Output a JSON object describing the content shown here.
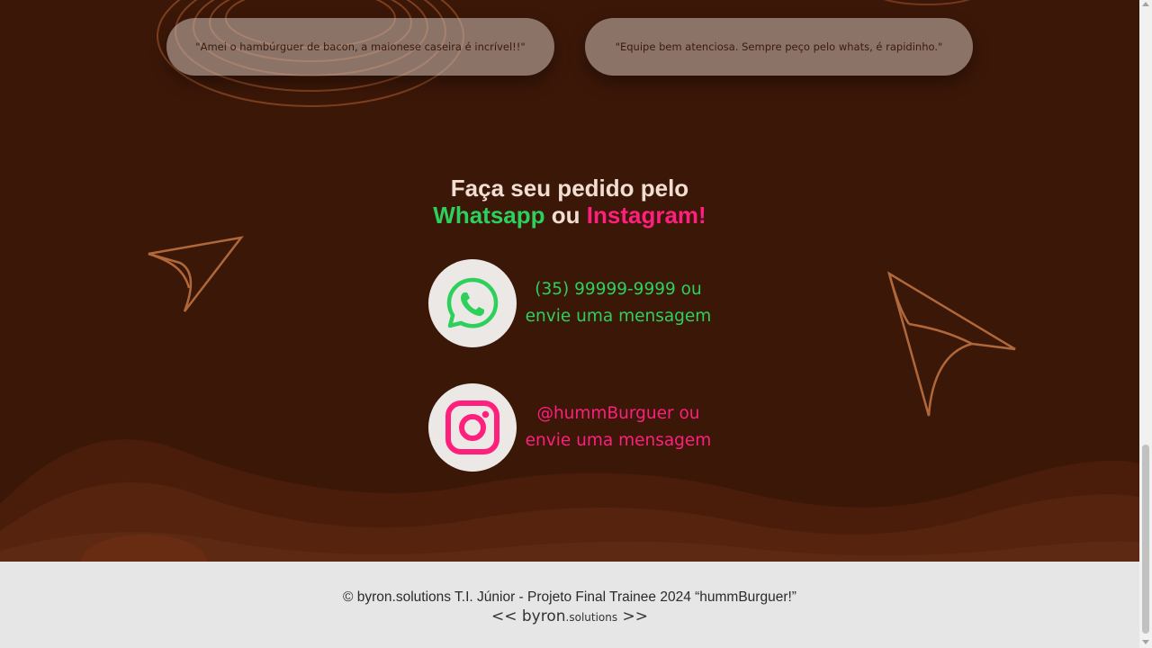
{
  "testimonials": [
    {
      "text": "\"Amei o hambúrguer de bacon, a maionese caseira é incrível!!\""
    },
    {
      "text": "\"Equipe bem atenciosa. Sempre peço pelo whats, é rapidinho.\""
    }
  ],
  "cta": {
    "line1": "Faça seu pedido pelo",
    "whatsapp": "Whatsapp",
    "or": "ou",
    "instagram": "Instagram!"
  },
  "contacts": {
    "whatsapp": {
      "line1": "(35) 99999-9999 ou",
      "line2": "envie uma mensagem",
      "icon": "whatsapp-icon"
    },
    "instagram": {
      "line1": "@hummBurguer ou",
      "line2": "envie uma mensagem",
      "icon": "instagram-icon"
    }
  },
  "footer": {
    "copyright": "© byron.solutions T.I. Júnior - Projeto Final Trainee 2024 “hummBurguer!”",
    "logo_left": "<<",
    "logo_main": "byron",
    "logo_sub": ".solutions",
    "logo_right": ">>"
  },
  "colors": {
    "background": "#3b1708",
    "whatsapp": "#2ed05c",
    "instagram": "#ff1f7d",
    "accent_lines": "#b0683a",
    "footer_bg": "#e6e6e6"
  }
}
